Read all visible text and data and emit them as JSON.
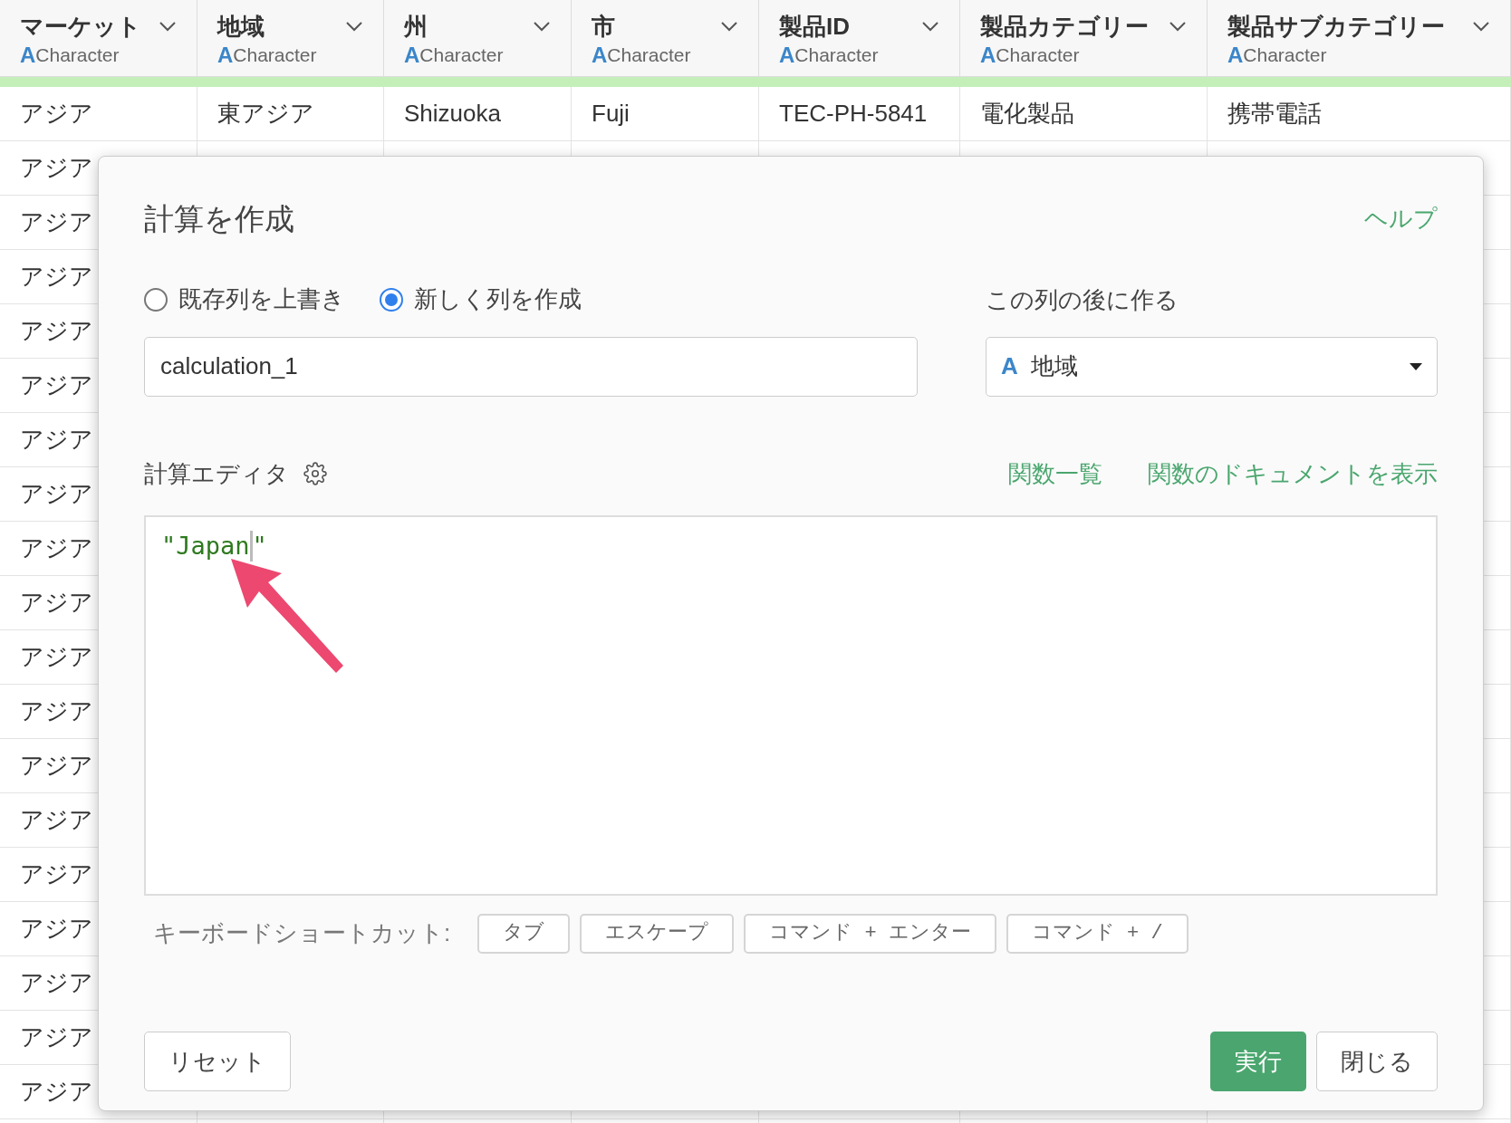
{
  "table": {
    "columns": [
      {
        "name": "マーケット",
        "type_mark": "A",
        "type": "Character"
      },
      {
        "name": "地域",
        "type_mark": "A",
        "type": "Character"
      },
      {
        "name": "州",
        "type_mark": "A",
        "type": "Character"
      },
      {
        "name": "市",
        "type_mark": "A",
        "type": "Character"
      },
      {
        "name": "製品ID",
        "type_mark": "A",
        "type": "Character"
      },
      {
        "name": "製品カテゴリー",
        "type_mark": "A",
        "type": "Character"
      },
      {
        "name": "製品サブカテゴリー",
        "type_mark": "A",
        "type": "Character"
      }
    ],
    "rows": [
      [
        "アジア",
        "東アジア",
        "Shizuoka",
        "Fuji",
        "TEC-PH-5841",
        "電化製品",
        "携帯電話"
      ],
      [
        "アジア"
      ],
      [
        "アジア"
      ],
      [
        "アジア"
      ],
      [
        "アジア"
      ],
      [
        "アジア"
      ],
      [
        "アジア"
      ],
      [
        "アジア"
      ],
      [
        "アジア"
      ],
      [
        "アジア"
      ],
      [
        "アジア"
      ],
      [
        "アジア"
      ],
      [
        "アジア"
      ],
      [
        "アジア"
      ],
      [
        "アジア"
      ],
      [
        "アジア"
      ],
      [
        "アジア"
      ],
      [
        "アジア"
      ],
      [
        "アジア"
      ]
    ]
  },
  "dialog": {
    "title": "計算を作成",
    "help_link": "ヘルプ",
    "modes": [
      {
        "label": "既存列を上書き",
        "selected": false
      },
      {
        "label": "新しく列を作成",
        "selected": true
      }
    ],
    "column_name_value": "calculation_1",
    "position_label": "この列の後に作る",
    "position_select": {
      "type_mark": "A",
      "value": "地域"
    },
    "editor": {
      "label": "計算エディタ",
      "links": [
        "関数一覧",
        "関数のドキュメントを表示"
      ],
      "code_before_caret": "\"Japan",
      "code_after_caret": "\""
    },
    "shortcuts": {
      "label": "キーボードショートカット:",
      "keys": [
        "タブ",
        "エスケープ",
        "コマンド + エンター",
        "コマンド + /"
      ]
    },
    "buttons": {
      "reset": "リセット",
      "run": "実行",
      "close": "閉じる"
    }
  }
}
